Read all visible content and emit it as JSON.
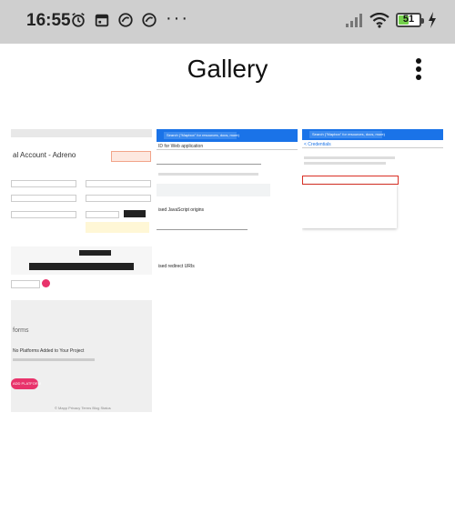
{
  "status_bar": {
    "time": "16:55",
    "more_dots": "···",
    "battery_level": "51",
    "battery_fraction": 0.51
  },
  "app_bar": {
    "title": "Gallery"
  },
  "gallery": {
    "items": [
      {
        "heading": "al Account - Adreno",
        "projects_heading": "forms",
        "empty_title": "No Platforms Added to Your Project",
        "button_label": "ADD PLATFORM",
        "footer_links": "© Mapp   Privacy   Terms   Blog   Status"
      },
      {
        "search_text": "Search (\"Mapbox\" for resources, docs, more)",
        "tab_text": "ID for Web application",
        "origins_heading": "ised JavaScript origins",
        "redirects_heading": "ised redirect URIs"
      },
      {
        "search_text": "Search (\"Mapbox\" for resources, docs, more)",
        "crumb_text": "< Credentials"
      }
    ]
  }
}
